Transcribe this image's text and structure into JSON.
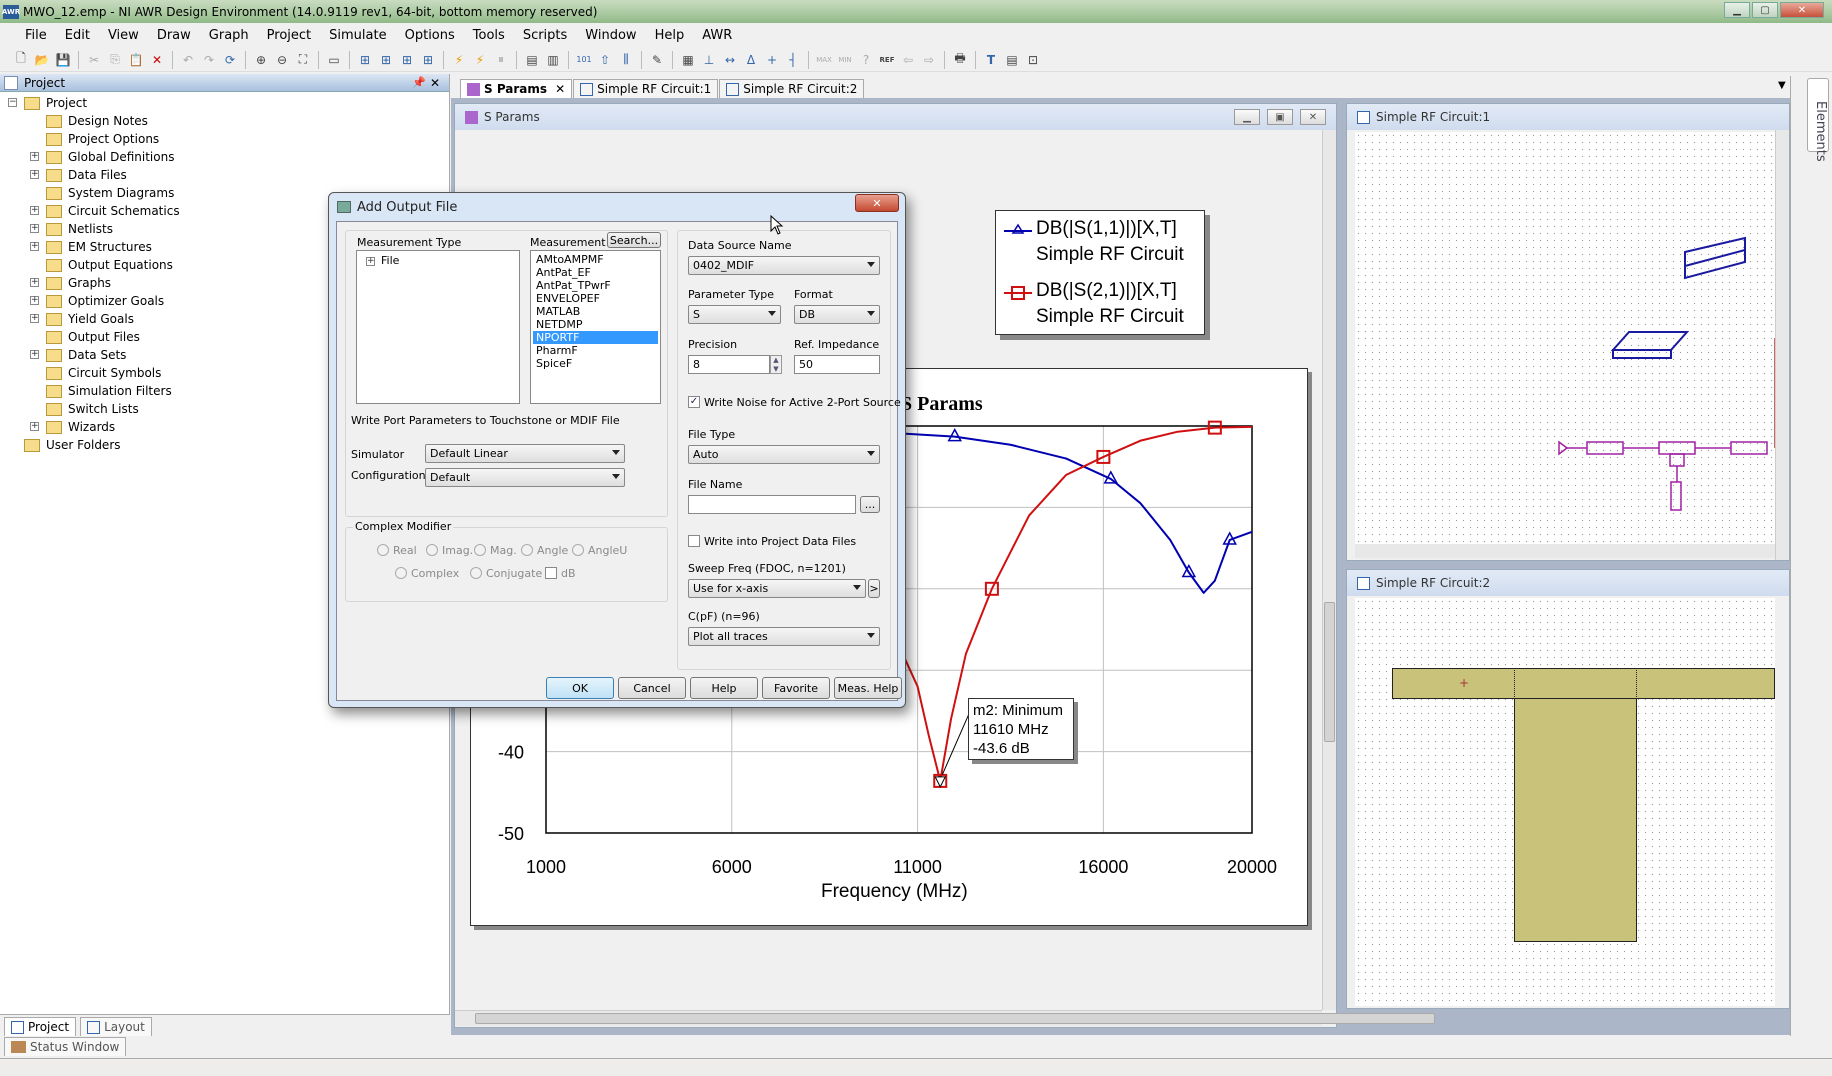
{
  "window": {
    "title": "MWO_12.emp - NI AWR Design Environment (14.0.9119 rev1, 64-bit, bottom memory reserved)",
    "app_icon": "awr-app-icon",
    "controls": [
      "minimize",
      "maximize",
      "close"
    ]
  },
  "menu": [
    "File",
    "Edit",
    "View",
    "Draw",
    "Graph",
    "Project",
    "Simulate",
    "Options",
    "Tools",
    "Scripts",
    "Window",
    "Help",
    "AWR"
  ],
  "toolbar": {
    "icons": [
      "new-icon",
      "open-icon",
      "save-icon",
      "cut-icon",
      "copy-icon",
      "paste-icon",
      "delete-icon",
      "undo-icon",
      "redo-icon",
      "refresh-icon",
      "zoom-area-icon",
      "zoom-out-icon",
      "view-all-icon",
      "add-graph-icon",
      "schematic-icon",
      "schematic2-icon",
      "schematic3-icon",
      "schematic4-icon",
      "simulate-icon",
      "tune-icon",
      "pause-icon",
      "properties-icon",
      "equation-icon",
      "bits-icon",
      "up-icon",
      "connect-icon",
      "wizard-icon",
      "layout-icon",
      "marker-icon",
      "hline-icon",
      "delta-icon",
      "plus-icon",
      "vline-icon",
      "max-icon",
      "min-icon",
      "help-icon",
      "ref-icon",
      "back-icon",
      "forward-icon",
      "print-icon",
      "text-icon",
      "box-icon",
      "frame-icon"
    ]
  },
  "project_panel": {
    "title": "Project",
    "tree": [
      {
        "label": "Project",
        "level": 0,
        "expander": "minus",
        "icon": "project-icon"
      },
      {
        "label": "Design Notes",
        "level": 1,
        "expander": null,
        "icon": "notes-icon"
      },
      {
        "label": "Project Options",
        "level": 1,
        "expander": null,
        "icon": "options-icon"
      },
      {
        "label": "Global Definitions",
        "level": 1,
        "expander": "plus",
        "icon": "definitions-icon"
      },
      {
        "label": "Data Files",
        "level": 1,
        "expander": "plus",
        "icon": "data-files-icon"
      },
      {
        "label": "System Diagrams",
        "level": 1,
        "expander": null,
        "icon": "system-diagram-icon"
      },
      {
        "label": "Circuit Schematics",
        "level": 1,
        "expander": "plus",
        "icon": "schematic-icon"
      },
      {
        "label": "Netlists",
        "level": 1,
        "expander": "plus",
        "icon": "folder-icon"
      },
      {
        "label": "EM Structures",
        "level": 1,
        "expander": "plus",
        "icon": "em-icon"
      },
      {
        "label": "Output Equations",
        "level": 1,
        "expander": null,
        "icon": "equations-icon"
      },
      {
        "label": "Graphs",
        "level": 1,
        "expander": "plus",
        "icon": "graphs-icon"
      },
      {
        "label": "Optimizer Goals",
        "level": 1,
        "expander": "plus",
        "icon": "optimizer-icon"
      },
      {
        "label": "Yield Goals",
        "level": 1,
        "expander": "plus",
        "icon": "yield-icon"
      },
      {
        "label": "Output Files",
        "level": 1,
        "expander": null,
        "icon": "output-files-icon"
      },
      {
        "label": "Data Sets",
        "level": 1,
        "expander": "plus",
        "icon": "data-sets-icon"
      },
      {
        "label": "Circuit Symbols",
        "level": 1,
        "expander": null,
        "icon": "symbols-icon"
      },
      {
        "label": "Simulation Filters",
        "level": 1,
        "expander": null,
        "icon": "filters-icon"
      },
      {
        "label": "Switch Lists",
        "level": 1,
        "expander": null,
        "icon": "switch-icon"
      },
      {
        "label": "Wizards",
        "level": 1,
        "expander": "plus",
        "icon": "wizards-icon"
      },
      {
        "label": "User Folders",
        "level": 0,
        "expander": null,
        "icon": "folder-icon"
      }
    ],
    "bottom_tabs": [
      "Project",
      "Layout"
    ],
    "status_tab": "Status Window"
  },
  "doc_tabs": [
    {
      "label": "S Params",
      "active": true,
      "closable": true
    },
    {
      "label": "Simple RF Circuit:1",
      "active": false
    },
    {
      "label": "Simple RF Circuit:2",
      "active": false
    }
  ],
  "sparams_window": {
    "title": "S Params",
    "chart_title_visible": "ams"
  },
  "chart_data": {
    "type": "line",
    "title": "S Params",
    "xlabel": "Frequency (MHz)",
    "ylabel": "",
    "xlim": [
      1000,
      20000
    ],
    "ylim": [
      -50,
      0
    ],
    "x_ticks": [
      "1000",
      "6000",
      "11000",
      "16000",
      "20000"
    ],
    "y_ticks": [
      "-40",
      "-50"
    ],
    "grid": true,
    "legend_position": "top-right",
    "series": [
      {
        "name": "DB(|S(1,1)|)[X,T]",
        "source": "Simple RF Circuit",
        "color": "#0000b0",
        "marker": "triangle",
        "x": [
          1000,
          4000,
          7000,
          9000,
          12000,
          13500,
          15000,
          16200,
          17000,
          17800,
          18300,
          18700,
          19000,
          19400,
          20000
        ],
        "y": [
          0,
          -0.1,
          -0.3,
          -0.5,
          -1.3,
          -2.3,
          -4.0,
          -6.5,
          -9.5,
          -14,
          -18,
          -20.5,
          -19,
          -14,
          -13
        ]
      },
      {
        "name": "DB(|S(2,1)|)[X,T]",
        "source": "Simple RF Circuit",
        "color": "#d01010",
        "marker": "square",
        "x": [
          9000,
          10000,
          11000,
          11300,
          11610,
          11900,
          12300,
          13000,
          14000,
          15000,
          16000,
          17000,
          18000,
          19000,
          20000
        ],
        "y": [
          -15,
          -22,
          -32,
          -38,
          -43.6,
          -36,
          -28,
          -20,
          -11,
          -6,
          -3.8,
          -1.8,
          -0.7,
          -0.2,
          -0.1
        ]
      }
    ],
    "marker": {
      "label": "m2: Minimum",
      "freq": "11610 MHz",
      "value": "-43.6 dB",
      "x": 11610,
      "y": -43.6
    }
  },
  "dialog": {
    "title": "Add Output File",
    "measurement_type_label": "Measurement Type",
    "measurement_type_tree": [
      "File"
    ],
    "measurement_label": "Measurement",
    "search_button": "Search...",
    "measurements": [
      "AMtoAMPMF",
      "AntPat_EF",
      "AntPat_TPwrF",
      "ENVELOPEF",
      "MATLAB",
      "NETDMP",
      "NPORTF",
      "PharmF",
      "SpiceF"
    ],
    "selected_measurement": "NPORTF",
    "description": "Write Port Parameters to Touchstone or MDIF File",
    "simulator_label": "Simulator",
    "simulator_value": "Default Linear",
    "configuration_label": "Configuration",
    "configuration_value": "Default",
    "complex_modifier": {
      "label": "Complex Modifier",
      "options": [
        "Real",
        "Imag.",
        "Mag.",
        "Angle",
        "AngleU",
        "Complex",
        "Conjugate"
      ],
      "db_label": "dB",
      "enabled": false
    },
    "data_source_label": "Data Source Name",
    "data_source_value": "0402_MDIF",
    "parameter_type_label": "Parameter Type",
    "parameter_type_value": "S",
    "format_label": "Format",
    "format_value": "DB",
    "precision_label": "Precision",
    "precision_value": "8",
    "ref_impedance_label": "Ref. Impedance",
    "ref_impedance_value": "50",
    "write_noise_label": "Write Noise for Active 2-Port Source",
    "write_noise_checked": true,
    "file_type_label": "File Type",
    "file_type_value": "Auto",
    "file_name_label": "File Name",
    "file_name_value": "",
    "browse_button": "...",
    "write_project_label": "Write into Project Data Files",
    "write_project_checked": false,
    "sweep_label": "Sweep Freq  (FDOC, n=1201)",
    "sweep_value": "Use for x-axis",
    "sweep_more": ">",
    "cpf_label": "C(pF)  (n=96)",
    "cpf_value": "Plot all traces",
    "buttons": [
      "OK",
      "Cancel",
      "Help",
      "Favorite",
      "Meas. Help"
    ]
  },
  "circuit1": {
    "title": "Simple RF Circuit:1"
  },
  "circuit2": {
    "title": "Simple RF Circuit:2"
  },
  "side_tab": "Elements"
}
